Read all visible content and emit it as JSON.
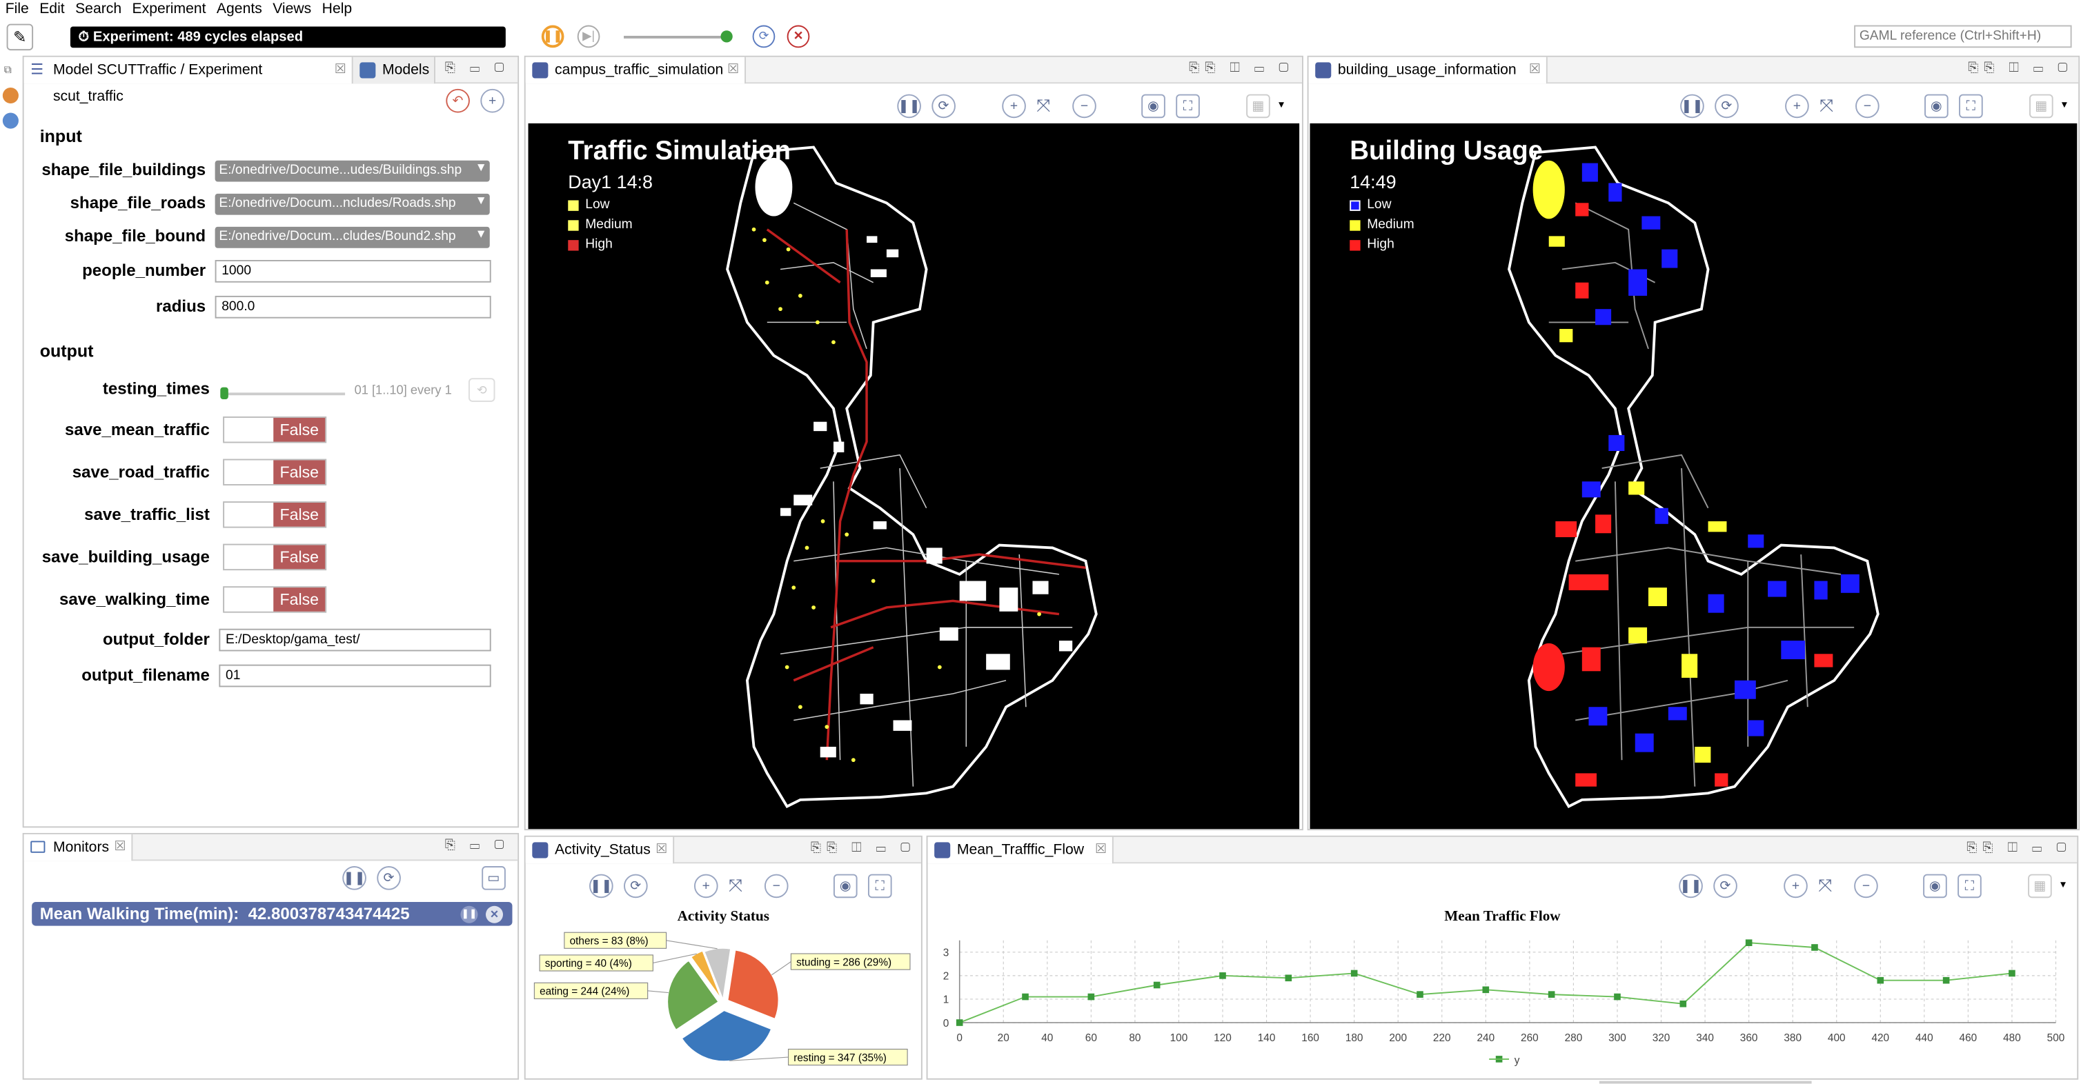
{
  "menu": [
    "File",
    "Edit",
    "Search",
    "Experiment",
    "Agents",
    "Views",
    "Help"
  ],
  "toolbar": {
    "experiment_status": "Experiment: 489 cycles elapsed",
    "gaml_reference_placeholder": "GAML reference (Ctrl+Shift+H)"
  },
  "left_panel": {
    "tabs": [
      {
        "label": "Model SCUTTraffic / Experiment scut_traffic"
      },
      {
        "label": "Models"
      }
    ],
    "input_header": "input",
    "output_header": "output",
    "params": {
      "shape_file_buildings": {
        "label": "shape_file_buildings",
        "value": "E:/onedrive/Docume...udes/Buildings.shp"
      },
      "shape_file_roads": {
        "label": "shape_file_roads",
        "value": "E:/onedrive/Docum...ncludes/Roads.shp"
      },
      "shape_file_bound": {
        "label": "shape_file_bound",
        "value": "E:/onedrive/Docum...cludes/Bound2.shp"
      },
      "people_number": {
        "label": "people_number",
        "value": "1000"
      },
      "radius": {
        "label": "radius",
        "value": "800.0"
      },
      "testing_times": {
        "label": "testing_times",
        "value": "01 [1..10] every 1",
        "slider_fraction": 0.0
      },
      "save_mean_traffic": {
        "label": "save_mean_traffic",
        "value": "False"
      },
      "save_road_traffic": {
        "label": "save_road_traffic",
        "value": "False"
      },
      "save_traffic_list": {
        "label": "save_traffic_list",
        "value": "False"
      },
      "save_building_usage": {
        "label": "save_building_usage",
        "value": "False"
      },
      "save_walking_time": {
        "label": "save_walking_time",
        "value": "False"
      },
      "output_folder": {
        "label": "output_folder",
        "value": "E:/Desktop/gama_test/"
      },
      "output_filename": {
        "label": "output_filename",
        "value": "01"
      }
    }
  },
  "traffic_view": {
    "tab": "campus_traffic_simulation",
    "title": "Traffic Simulation",
    "subtitle": "Day1  14:8",
    "legend": [
      {
        "label": "Low",
        "color": "#ffff66"
      },
      {
        "label": "Medium",
        "color": "#ffff66"
      },
      {
        "label": "High",
        "color": "#e03030"
      }
    ]
  },
  "building_view": {
    "tab": "building_usage_information",
    "title": "Building Usage",
    "subtitle": "14:49",
    "legend": [
      {
        "label": "Low",
        "color": "#1a1aff"
      },
      {
        "label": "Medium",
        "color": "#ffff33"
      },
      {
        "label": "High",
        "color": "#ff2020"
      }
    ]
  },
  "monitors": {
    "tab": "Monitors",
    "monitor_label": "Mean Walking Time(min):",
    "monitor_value": "42.800378743474425"
  },
  "activity": {
    "tab": "Activity_Status",
    "chart_data": {
      "type": "pie",
      "title": "Activity Status",
      "slices": [
        {
          "label": "studing = 286 (29%)",
          "value": 286,
          "color": "#e8603c"
        },
        {
          "label": "resting = 347 (35%)",
          "value": 347,
          "color": "#3a78bd"
        },
        {
          "label": "eating = 244 (24%)",
          "value": 244,
          "color": "#6aa84f"
        },
        {
          "label": "sporting = 40 (4%)",
          "value": 40,
          "color": "#f2b03c"
        },
        {
          "label": "others = 83 (8%)",
          "value": 83,
          "color": "#c8c8c8"
        }
      ]
    }
  },
  "traffic_flow": {
    "tab": "Mean_Trafffic_Flow",
    "chart_data": {
      "type": "line",
      "title": "Mean Traffic Flow",
      "x": [
        0,
        30,
        60,
        90,
        120,
        150,
        180,
        210,
        240,
        270,
        300,
        330,
        360,
        390,
        420,
        450,
        480
      ],
      "series": [
        {
          "name": "y",
          "color": "#6bbf59",
          "values": [
            0,
            1.1,
            1.1,
            1.6,
            2.0,
            1.9,
            2.1,
            1.2,
            1.4,
            1.2,
            1.1,
            0.8,
            3.4,
            3.2,
            1.8,
            1.8,
            2.1
          ]
        }
      ],
      "xticks": [
        0,
        20,
        40,
        60,
        80,
        100,
        120,
        140,
        160,
        180,
        200,
        220,
        240,
        260,
        280,
        300,
        320,
        340,
        360,
        380,
        400,
        420,
        440,
        460,
        480,
        500
      ],
      "yticks": [
        0,
        1,
        2,
        3
      ],
      "xlim": [
        0,
        500
      ],
      "ylim": [
        0,
        3.5
      ],
      "legend": "bottom",
      "grid": true
    }
  }
}
